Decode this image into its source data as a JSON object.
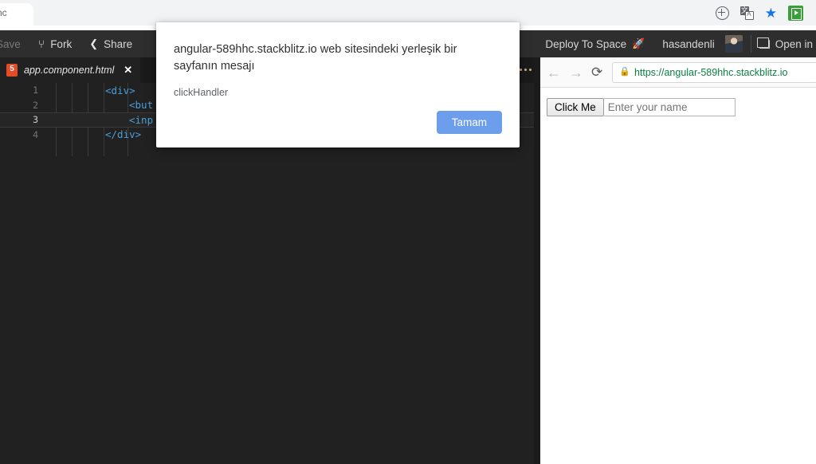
{
  "browser": {
    "tab_title": "nc",
    "omnibox_icons": [
      {
        "name": "zoom-in-icon",
        "glyph": "zoom"
      },
      {
        "name": "translate-icon",
        "glyph": "translate"
      },
      {
        "name": "bookmark-star-icon",
        "glyph": "star",
        "color": "#1a73e8"
      },
      {
        "name": "extension-icon",
        "glyph": "green-app",
        "color": "#3a9e3a"
      }
    ]
  },
  "toolbar": {
    "save_label": "Save",
    "fork_label": "Fork",
    "share_label": "Share",
    "deploy_label": "Deploy To Space",
    "deploy_icon": "rocket-icon",
    "username": "hasandenli",
    "open_label": "Open in",
    "fork_icon": "fork-icon",
    "share_icon": "share-icon",
    "open_icon": "open-in-new-icon"
  },
  "editor": {
    "tab": {
      "filename": "app.component.html",
      "file_icon": "html5-icon",
      "close_icon": "close-icon"
    },
    "more_icon": "more-options-icon",
    "active_line": 3,
    "lines": [
      {
        "num": "1",
        "text": "<div>",
        "indent": 0
      },
      {
        "num": "2",
        "text": "<but",
        "indent": 1
      },
      {
        "num": "3",
        "text": "<inp",
        "indent": 1
      },
      {
        "num": "4",
        "text": "</div>",
        "indent": 0
      }
    ]
  },
  "preview": {
    "back_icon": "back-arrow-icon",
    "forward_icon": "forward-arrow-icon",
    "reload_icon": "reload-icon",
    "lock_icon": "lock-icon",
    "url": "https://angular-589hhc.stackblitz.io",
    "button_label": "Click Me",
    "input_placeholder": "Enter your name"
  },
  "dialog": {
    "message": "angular-589hhc.stackblitz.io web sitesindeki yerleşik bir sayfanın mesajı",
    "detail": "clickHandler",
    "ok_label": "Tamam",
    "ok_color": "#6d9eeb"
  }
}
